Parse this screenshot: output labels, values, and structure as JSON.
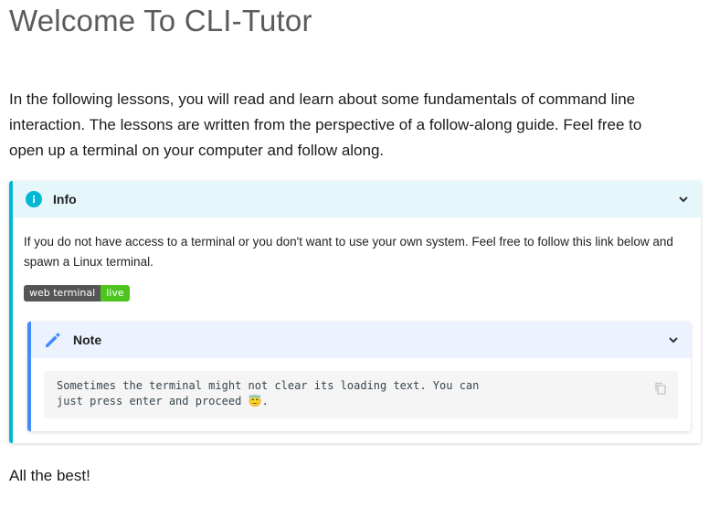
{
  "page": {
    "title": "Welcome To CLI-Tutor",
    "intro": "In the following lessons, you will read and learn about some fundamentals of command line interaction. The lessons are written from the perspective of a follow-along guide. Feel free to open up a terminal on your computer and follow along.",
    "closing": "All the best!"
  },
  "info": {
    "label": "Info",
    "icon": "info-icon",
    "body": "If you do not have access to a terminal or you don't want to use your own system. Feel free to follow this link below and spawn a Linux terminal.",
    "badge_left": "web terminal",
    "badge_right": "live"
  },
  "note": {
    "label": "Note",
    "icon": "pencil-icon",
    "code_line1": "Sometimes the terminal might not clear its loading text. You can",
    "code_line2": "just press enter and proceed 😇."
  },
  "colors": {
    "info_accent": "#00b8d4",
    "note_accent": "#448aff",
    "badge_live": "#4cc61e"
  }
}
